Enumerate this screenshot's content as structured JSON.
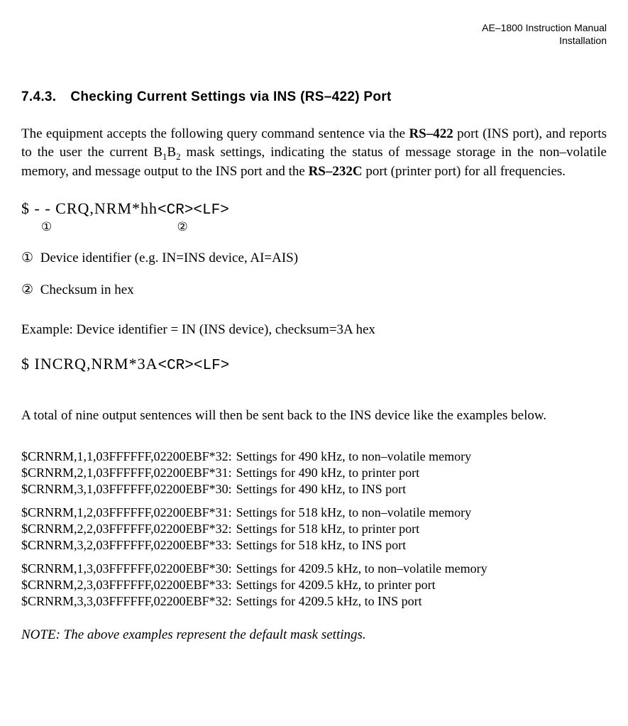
{
  "header": {
    "line1": "AE–1800 Instruction Manual",
    "line2": "Installation"
  },
  "heading": {
    "number": "7.4.3.",
    "title": "Checking Current Settings via INS (RS–422) Port"
  },
  "intro": {
    "t1": "The equipment accepts the following query command sentence via the ",
    "b1": "RS–422",
    "t2": " port (INS port), and reports to the user the current B",
    "s1": "1",
    "t3": "B",
    "s2": "2",
    "t4": " mask settings, indicating the status of message storage in the non–volatile memory, and message output to the INS port and the ",
    "b2": "RS–232C",
    "t5": " port (printer port) for all frequencies."
  },
  "cmd_template": {
    "text": "$ - - CRQ,NRM*hh",
    "crlf": "<CR><LF>"
  },
  "markers": {
    "m1": "①",
    "m2": "②"
  },
  "definitions": [
    {
      "marker": "①",
      "text": "Device identifier (e.g. IN=INS device, AI=AIS)"
    },
    {
      "marker": "②",
      "text": "Checksum in hex"
    }
  ],
  "example_intro": "Example: Device identifier = IN (INS device), checksum=3A hex",
  "cmd_example": {
    "text": "$ INCRQ,NRM*3A",
    "crlf": "<CR><LF>"
  },
  "output_intro": "A total of nine output sentences will then be sent back to the INS device like the examples below.",
  "settings_rows": [
    {
      "code": "$CRNRM,1,1,03FFFFFF,02200EBF*32:",
      "desc": "Settings for 490 kHz, to non–volatile memory",
      "gap": false
    },
    {
      "code": "$CRNRM,2,1,03FFFFFF,02200EBF*31:",
      "desc": "Settings for 490 kHz, to printer port",
      "gap": false
    },
    {
      "code": "$CRNRM,3,1,03FFFFFF,02200EBF*30:",
      "desc": "Settings for 490 kHz, to INS port",
      "gap": false
    },
    {
      "code": "$CRNRM,1,2,03FFFFFF,02200EBF*31:",
      "desc": "Settings for 518 kHz, to non–volatile memory",
      "gap": true
    },
    {
      "code": "$CRNRM,2,2,03FFFFFF,02200EBF*32:",
      "desc": "Settings for 518 kHz, to printer port",
      "gap": false
    },
    {
      "code": "$CRNRM,3,2,03FFFFFF,02200EBF*33:",
      "desc": "Settings for 518 kHz, to INS port",
      "gap": false
    },
    {
      "code": "$CRNRM,1,3,03FFFFFF,02200EBF*30:",
      "desc": "Settings for 4209.5 kHz, to non–volatile memory",
      "gap": true
    },
    {
      "code": "$CRNRM,2,3,03FFFFFF,02200EBF*33:",
      "desc": "Settings for 4209.5 kHz, to printer port",
      "gap": false
    },
    {
      "code": "$CRNRM,3,3,03FFFFFF,02200EBF*32:",
      "desc": "Settings for 4209.5 kHz, to INS port",
      "gap": false
    }
  ],
  "note": "NOTE: The above examples represent the default mask settings."
}
